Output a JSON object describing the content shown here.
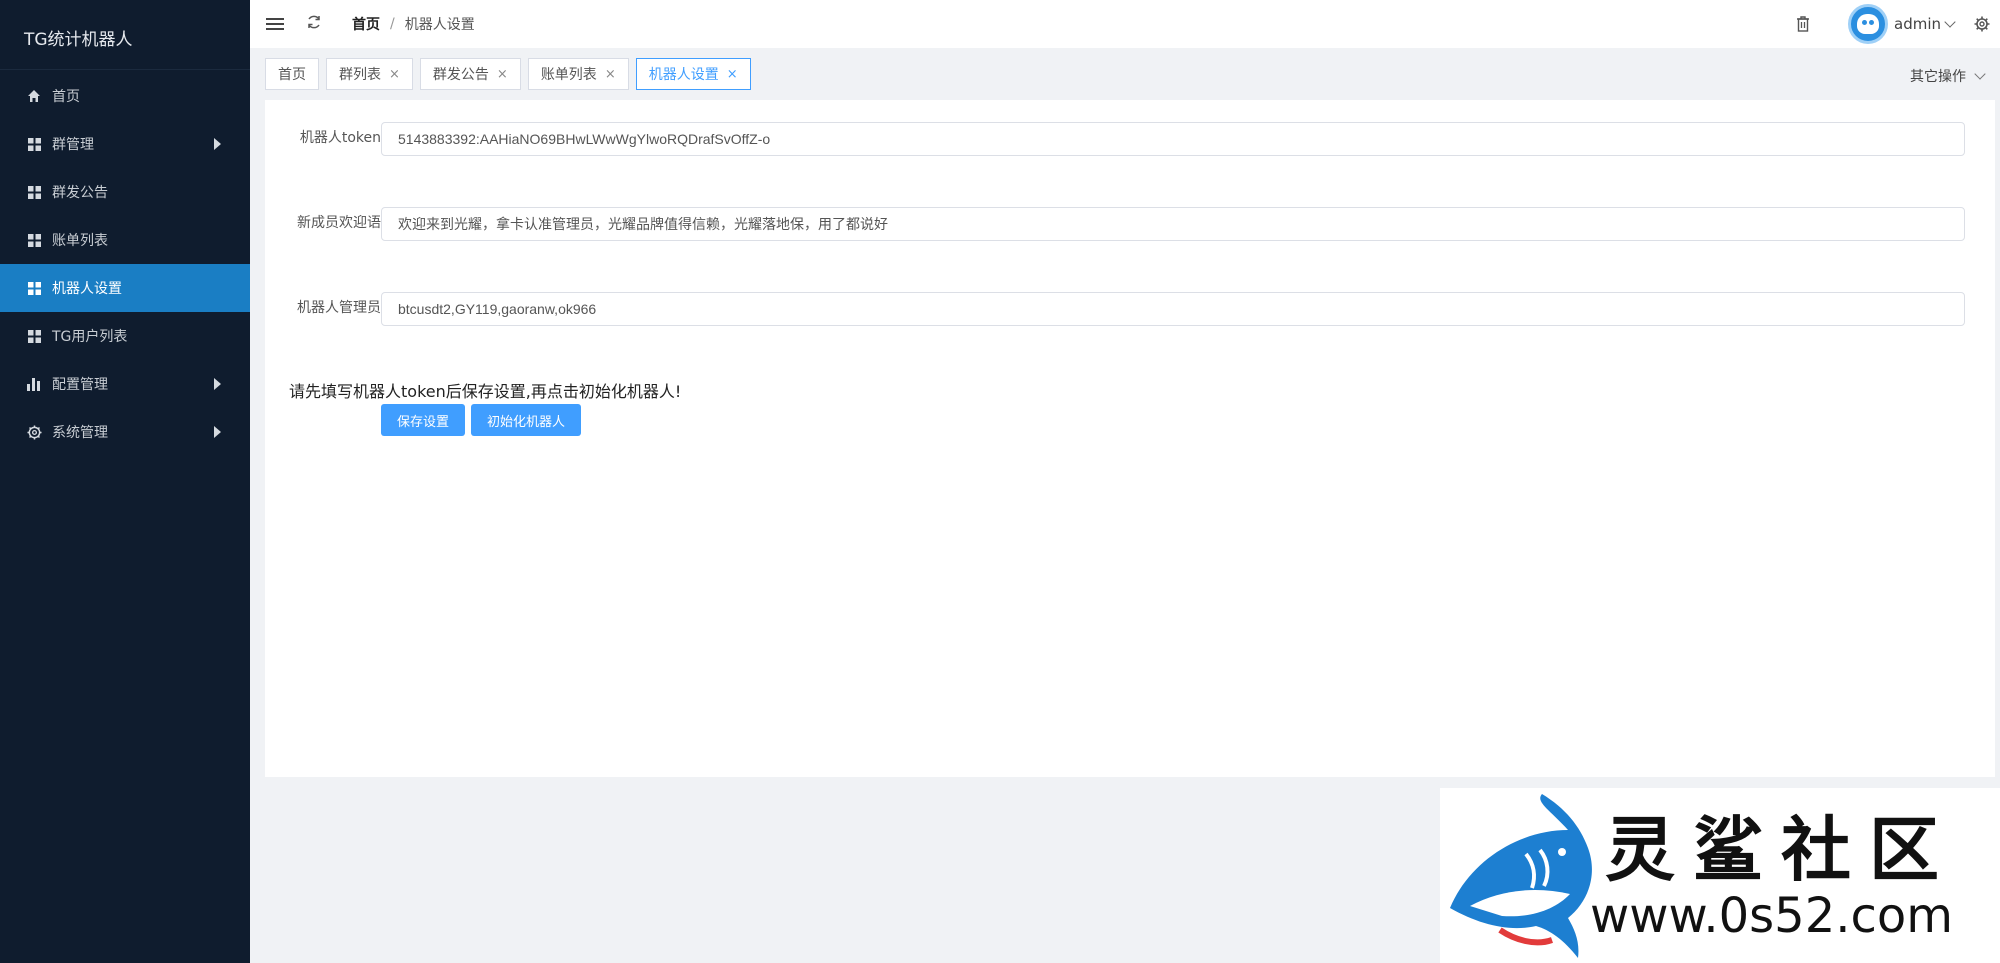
{
  "app": {
    "title": "TG统计机器人"
  },
  "sidebar": {
    "items": [
      {
        "label": "首页",
        "icon": "home-icon"
      },
      {
        "label": "群管理",
        "icon": "grid-icon",
        "has_submenu": true
      },
      {
        "label": "群发公告",
        "icon": "grid-icon"
      },
      {
        "label": "账单列表",
        "icon": "grid-icon"
      },
      {
        "label": "机器人设置",
        "icon": "grid-icon",
        "active": true
      },
      {
        "label": "TG用户列表",
        "icon": "grid-icon"
      },
      {
        "label": "配置管理",
        "icon": "bar-chart-icon",
        "has_submenu": true
      },
      {
        "label": "系统管理",
        "icon": "gear-icon",
        "has_submenu": true
      }
    ]
  },
  "header": {
    "breadcrumb": {
      "home": "首页",
      "separator": "/",
      "current": "机器人设置"
    },
    "user": "admin"
  },
  "tabs": {
    "items": [
      {
        "label": "首页",
        "closable": false
      },
      {
        "label": "群列表",
        "closable": true
      },
      {
        "label": "群发公告",
        "closable": true
      },
      {
        "label": "账单列表",
        "closable": true
      },
      {
        "label": "机器人设置",
        "closable": true,
        "active": true
      }
    ],
    "close_glyph": "×",
    "other_ops": "其它操作"
  },
  "form": {
    "token": {
      "label": "机器人token",
      "value": "5143883392:AAHiaNO69BHwLWwWgYlwoRQDrafSvOffZ-o"
    },
    "welcome": {
      "label": "新成员欢迎语",
      "value": "欢迎来到光耀，拿卡认准管理员，光耀品牌值得信赖，光耀落地保，用了都说好"
    },
    "admins": {
      "label": "机器人管理员",
      "value": "btcusdt2,GY119,gaoranw,ok966"
    },
    "notice": "请先填写机器人token后保存设置,再点击初始化机器人!",
    "save_button": "保存设置",
    "init_button": "初始化机器人"
  },
  "watermark": {
    "name": "灵鲨社区",
    "url": "www.0s52.com"
  },
  "colors": {
    "sidebar_bg": "#0f1c2e",
    "active": "#1a7ec4",
    "primary": "#409eff"
  }
}
